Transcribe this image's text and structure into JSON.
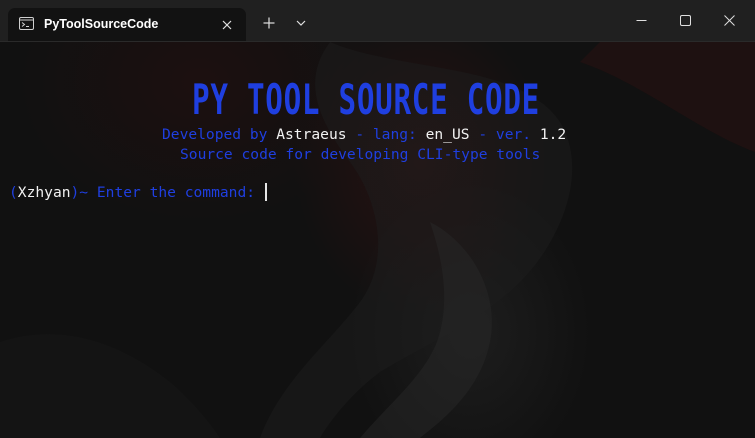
{
  "window": {
    "tab_title": "PyToolSourceCode",
    "tab_icon": "terminal-icon",
    "buttons": {
      "close_tab": "close-icon",
      "new_tab": "plus-icon",
      "dropdown": "chevron-down-icon",
      "minimize": "minimize-icon",
      "maximize": "maximize-icon",
      "close": "close-icon"
    }
  },
  "banner": {
    "text": "PY TOOL SOURCE CODE",
    "color": "#1f3fe0"
  },
  "info": {
    "developed_label": "Developed by ",
    "author": "Astraeus",
    "lang_label": " - lang: ",
    "lang": "en_US",
    "ver_label": " - ver. ",
    "version": "1.2",
    "description": "Source code for developing CLI-type tools"
  },
  "prompt": {
    "open_paren": "(",
    "user": "Xzhyan",
    "suffix": ")~ Enter the command: "
  },
  "colors": {
    "accent_blue": "#1f3fe0",
    "highlight_white": "#f2f2f2",
    "background": "#111111",
    "titlebar": "#202020"
  }
}
